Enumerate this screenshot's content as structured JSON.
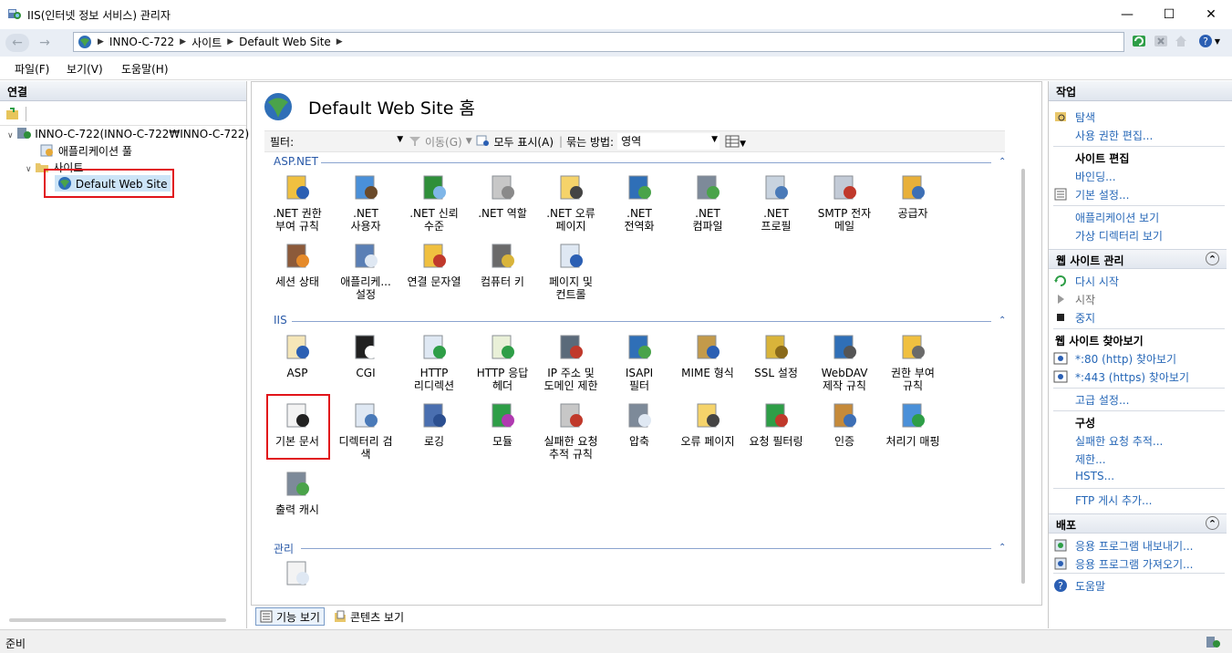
{
  "window": {
    "title": "IIS(인터넷 정보 서비스) 관리자",
    "minimize": "—",
    "maximize": "☐",
    "close": "✕"
  },
  "address": {
    "crumbs": [
      "INNO-C-722",
      "사이트",
      "Default Web Site"
    ]
  },
  "menu": [
    "파일(F)",
    "보기(V)",
    "도움말(H)"
  ],
  "connections": {
    "header": "연결",
    "tree": {
      "server": "INNO-C-722(INNO-C-722₩INNO-C-722)",
      "app_pools": "애플리케이션 풀",
      "sites": "사이트",
      "site": "Default Web Site"
    }
  },
  "center": {
    "title": "Default Web Site 홈",
    "filter": {
      "label": "필터:",
      "go": "이동(G)",
      "show_all": "모두 표시(A)",
      "group_by_label": "묶는 방법:",
      "group_by_value": "영역"
    },
    "groups": [
      {
        "name": "ASP.NET",
        "items": [
          ".NET 권한 부여 규칙",
          ".NET 사용자",
          ".NET 신뢰 수준",
          ".NET 역할",
          ".NET 오류 페이지",
          ".NET 전역화",
          ".NET 컴파일",
          ".NET 프로필",
          "SMTP 전자 메일",
          "공급자",
          "세션 상태",
          "애플리케... 설정",
          "연결 문자열",
          "컴퓨터 키",
          "페이지 및 컨트롤"
        ]
      },
      {
        "name": "IIS",
        "items": [
          "ASP",
          "CGI",
          "HTTP 리디렉션",
          "HTTP 응답 헤더",
          "IP 주소 및 도메인 제한",
          "ISAPI 필터",
          "MIME 형식",
          "SSL 설정",
          "WebDAV 제작 규칙",
          "권한 부여 규칙",
          "기본 문서",
          "디렉터리 검색",
          "로깅",
          "모듈",
          "실패한 요청 추적 규칙",
          "압축",
          "오류 페이지",
          "요청 필터링",
          "인증",
          "처리기 매핑",
          "출력 캐시"
        ]
      },
      {
        "name": "관리",
        "items": [
          ""
        ]
      }
    ],
    "tabs": {
      "features": "기능 보기",
      "content": "콘텐츠 보기"
    }
  },
  "actions": {
    "header": "작업",
    "explore": "탐색",
    "edit_perms": "사용 권한 편집...",
    "edit_site": "사이트 편집",
    "bindings": "바인딩...",
    "basic_settings": "기본 설정...",
    "view_apps": "애플리케이션 보기",
    "view_vdirs": "가상 디렉터리 보기",
    "manage_site": "웹 사이트 관리",
    "restart": "다시 시작",
    "start": "시작",
    "stop": "중지",
    "browse_site": "웹 사이트 찾아보기",
    "browse80": "*:80 (http) 찾아보기",
    "browse443": "*:443 (https) 찾아보기",
    "advanced": "고급 설정...",
    "configure": "구성",
    "failed_trace": "실패한 요청 추적...",
    "limits": "제한...",
    "hsts": "HSTS...",
    "ftp": "FTP 게시 추가...",
    "deploy": "배포",
    "export_app": "응용 프로그램 내보내기...",
    "import_app": "응용 프로그램 가져오기...",
    "help": "도움말"
  },
  "status": {
    "text": "준비"
  }
}
